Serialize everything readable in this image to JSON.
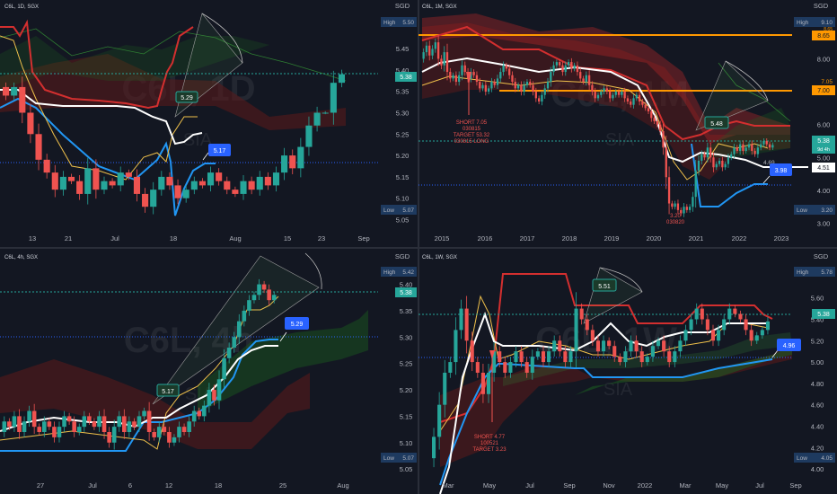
{
  "colors": {
    "background": "#131722",
    "up": "#26a69a",
    "down": "#ef5350",
    "tenkan": "#ffffff",
    "kijun": "#f0c14b",
    "support": "#2962ff",
    "resistance": "#d32f2f",
    "cloud_bull": "#1b5e20",
    "cloud_bear": "#5d1a1a",
    "current_price": "#26a69a",
    "grid_axis": "#2a2e39",
    "orange_level": "#ff9800",
    "badge_blue": "#2962ff"
  },
  "chart_data": [
    {
      "id": "daily",
      "type": "candlestick",
      "symbol_header": "C6L, 1D, SGX",
      "watermark": "C6L, 1D",
      "watermark_sub": "SIA",
      "currency": "SGD",
      "y_range": [
        5.03,
        5.53
      ],
      "y_ticks": [
        "5.45",
        "5.40",
        "5.35",
        "5.30",
        "5.25",
        "5.20",
        "5.15",
        "5.10",
        "5.05"
      ],
      "x_ticks": [
        "13",
        "21",
        "Jul",
        "18",
        "Aug",
        "15",
        "23",
        "Sep"
      ],
      "high_label": "High",
      "high_value": "5.50",
      "low_label": "Low",
      "low_value": "5.07",
      "current_value": "5.38",
      "target_badge": "5.29",
      "support_badge": "5.17",
      "closes": [
        5.34,
        5.36,
        5.3,
        5.25,
        5.19,
        5.16,
        5.12,
        5.15,
        5.14,
        5.11,
        5.17,
        5.12,
        5.14,
        5.13,
        5.16,
        5.15,
        5.11,
        5.08,
        5.12,
        5.15,
        5.13,
        5.1,
        5.12,
        5.14,
        5.13,
        5.16,
        5.14,
        5.12,
        5.11,
        5.14,
        5.12,
        5.15,
        5.13,
        5.16,
        5.2,
        5.17,
        5.22,
        5.27,
        5.3,
        5.3,
        5.37,
        5.39
      ],
      "open0": 5.36
    },
    {
      "id": "monthly",
      "type": "candlestick",
      "symbol_header": "C6L, 1M, SGX",
      "watermark": "C6L, 1M",
      "watermark_sub": "SIA",
      "currency": "SGD",
      "y_range": [
        2.85,
        9.35
      ],
      "y_ticks": [
        "8.00",
        "7.00",
        "6.00",
        "5.00",
        "4.00",
        "3.00"
      ],
      "x_ticks": [
        "2015",
        "2016",
        "2017",
        "2018",
        "2019",
        "2020",
        "2021",
        "2022",
        "2023"
      ],
      "high_label": "High",
      "high_value": "9.10",
      "low_label": "Low",
      "low_value": "3.20",
      "level_865": "8.65",
      "level_705": "7.05",
      "level_700": "7.00",
      "current_value": "5.38",
      "current_sub": "9d 4h",
      "level_451": "4.51",
      "label_469": "4.69",
      "target_badge": "5.48",
      "support_badge": "3.98",
      "short_note": [
        "SHORT 7.05",
        "030815",
        "TARGET 53.32",
        "030815 LONG"
      ],
      "low_note": [
        "3.20",
        "030820"
      ],
      "closes": [
        8.2,
        8.4,
        8.1,
        8.3,
        8.5,
        8.0,
        7.8,
        8.2,
        7.6,
        7.4,
        7.5,
        7.3,
        7.5,
        7.8,
        7.6,
        7.4,
        7.6,
        7.5,
        7.3,
        7.1,
        7.2,
        7.0,
        7.1,
        7.3,
        7.2,
        7.4,
        7.6,
        7.8,
        7.7,
        7.5,
        7.3,
        7.1,
        7.2,
        7.0,
        7.2,
        7.3,
        7.2,
        7.0,
        6.8,
        6.7,
        6.9,
        7.1,
        7.3,
        7.6,
        7.8,
        7.9,
        7.8,
        7.6,
        7.8,
        7.9,
        7.7,
        7.8,
        7.6,
        7.4,
        7.3,
        7.5,
        7.2,
        7.0,
        6.8,
        6.9,
        7.0,
        7.1,
        7.0,
        6.8,
        6.9,
        7.0,
        6.9,
        7.0,
        6.8,
        6.7,
        6.6,
        6.8,
        6.9,
        6.7,
        6.6,
        6.5,
        6.4,
        6.2,
        6.1,
        6.0,
        5.8,
        5.3,
        4.4,
        3.6,
        3.5,
        3.6,
        3.4,
        3.3,
        3.5,
        3.4,
        3.5,
        3.8,
        4.6,
        4.9,
        5.1,
        5.0,
        5.3,
        5.0,
        4.7,
        4.8,
        4.9,
        4.7,
        4.8,
        5.0,
        5.1,
        5.3,
        5.2,
        5.4,
        5.2,
        5.3,
        5.4,
        5.2,
        5.1,
        5.3,
        5.4,
        5.5,
        5.4,
        5.3,
        5.38
      ],
      "open0": 8.0
    },
    {
      "id": "four_hour",
      "type": "candlestick",
      "symbol_header": "C6L, 4h, SGX",
      "watermark": "C6L, 4h",
      "watermark_sub": "SIA",
      "currency": "SGD",
      "y_range": [
        5.04,
        5.435
      ],
      "y_ticks": [
        "5.40",
        "5.35",
        "5.30",
        "5.25",
        "5.20",
        "5.15",
        "5.10",
        "5.05"
      ],
      "x_ticks": [
        "27",
        "Jul",
        "6",
        "12",
        "18",
        "25",
        "Aug"
      ],
      "high_label": "High",
      "high_value": "5.42",
      "low_label": "Low",
      "low_value": "5.07",
      "current_value": "5.38",
      "target_badge": "5.29",
      "support_badge": "5.17",
      "closes": [
        5.14,
        5.13,
        5.15,
        5.12,
        5.14,
        5.16,
        5.13,
        5.12,
        5.14,
        5.13,
        5.11,
        5.13,
        5.15,
        5.14,
        5.12,
        5.13,
        5.15,
        5.14,
        5.13,
        5.15,
        5.12,
        5.1,
        5.13,
        5.15,
        5.12,
        5.14,
        5.13,
        5.15,
        5.16,
        5.12,
        5.11,
        5.13,
        5.12,
        5.1,
        5.11,
        5.13,
        5.12,
        5.14,
        5.16,
        5.15,
        5.17,
        5.2,
        5.18,
        5.22,
        5.26,
        5.28,
        5.3,
        5.33,
        5.35,
        5.37,
        5.38,
        5.4,
        5.39,
        5.37,
        5.38
      ],
      "open0": 5.12
    },
    {
      "id": "weekly",
      "type": "candlestick",
      "symbol_header": "C6L, 1W, SGX",
      "watermark": "C6L, 1W",
      "watermark_sub": "SIA",
      "currency": "SGD",
      "y_range": [
        3.95,
        5.9
      ],
      "y_ticks": [
        "5.60",
        "5.40",
        "5.20",
        "5.00",
        "4.80",
        "4.60",
        "4.40",
        "4.20",
        "4.00"
      ],
      "x_ticks": [
        "Mar",
        "May",
        "Jul",
        "Sep",
        "Nov",
        "2022",
        "Mar",
        "May",
        "Jul",
        "Sep"
      ],
      "high_label": "High",
      "high_value": "5.78",
      "low_label": "Low",
      "low_value": "4.05",
      "current_value": "5.38",
      "target_badge": "5.51",
      "support_badge": "4.96",
      "short_note": [
        "SHORT 4.77",
        "100521",
        "TARGET 3.23"
      ],
      "closes": [
        4.3,
        4.6,
        4.9,
        5.0,
        5.3,
        5.5,
        5.2,
        5.0,
        4.9,
        4.7,
        4.9,
        5.1,
        5.0,
        4.9,
        5.0,
        5.1,
        5.0,
        4.9,
        5.05,
        5.1,
        5.0,
        5.1,
        5.2,
        5.1,
        5.0,
        5.1,
        5.5,
        5.4,
        5.3,
        5.2,
        5.1,
        5.2,
        5.15,
        5.05,
        5.0,
        5.1,
        5.2,
        5.1,
        5.0,
        5.05,
        5.15,
        5.2,
        5.1,
        5.0,
        5.1,
        5.2,
        5.3,
        5.4,
        5.5,
        5.4,
        5.3,
        5.2,
        5.3,
        5.4,
        5.5,
        5.45,
        5.4,
        5.3,
        5.2,
        5.25,
        5.3,
        5.38
      ],
      "open0": 4.1
    }
  ]
}
